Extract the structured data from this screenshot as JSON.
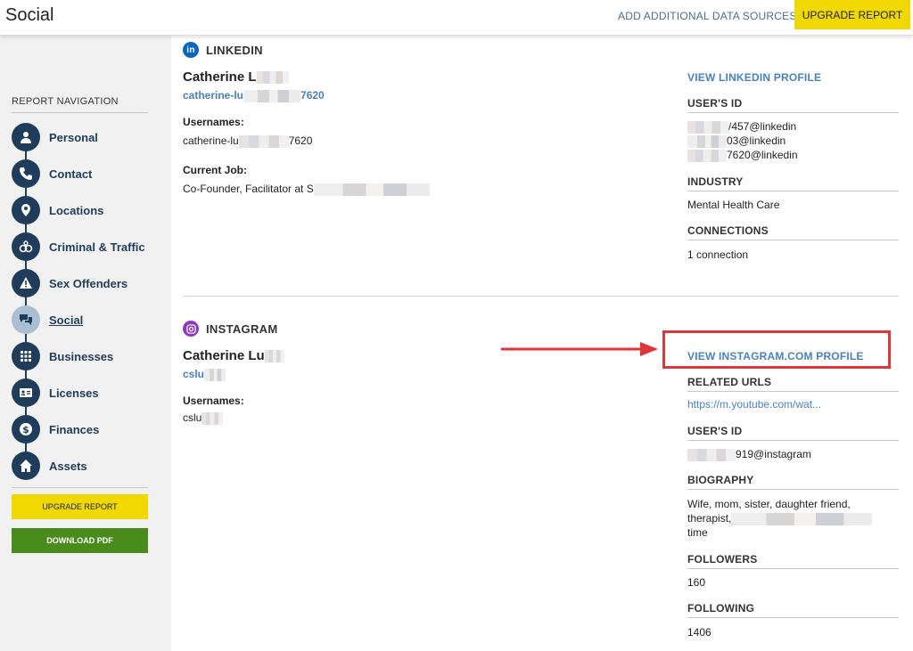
{
  "header": {
    "title": "Social",
    "add_sources": "ADD ADDITIONAL DATA SOURCES:",
    "upgrade": "UPGRADE REPORT"
  },
  "sidebar": {
    "heading": "REPORT NAVIGATION",
    "items": [
      {
        "label": "Personal",
        "icon": "person-icon"
      },
      {
        "label": "Contact",
        "icon": "phone-icon"
      },
      {
        "label": "Locations",
        "icon": "location-pin-icon"
      },
      {
        "label": "Criminal & Traffic",
        "icon": "handcuffs-icon"
      },
      {
        "label": "Sex Offenders",
        "icon": "warning-icon"
      },
      {
        "label": "Social",
        "icon": "chat-bubbles-icon",
        "active": true
      },
      {
        "label": "Businesses",
        "icon": "building-icon"
      },
      {
        "label": "Licenses",
        "icon": "id-card-icon"
      },
      {
        "label": "Finances",
        "icon": "dollar-icon"
      },
      {
        "label": "Assets",
        "icon": "home-icon"
      }
    ],
    "upgrade_button": "UPGRADE REPORT",
    "download_button": "DOWNLOAD PDF"
  },
  "linkedin": {
    "section_title": "LINKEDIN",
    "name": "Catherine L",
    "handle_prefix": "catherine-lu",
    "handle_suffix": "7620",
    "usernames_label": "Usernames:",
    "username_prefix": "catherine-lu",
    "username_suffix": "7620",
    "job_label": "Current Job:",
    "job_value": "Co-Founder, Facilitator at S",
    "view_profile": "VIEW LINKEDIN PROFILE",
    "user_id_label": "USER'S ID",
    "user_ids": [
      "/457@linkedin",
      "03@linkedin",
      "7620@linkedin"
    ],
    "industry_label": "INDUSTRY",
    "industry_value": "Mental Health Care",
    "connections_label": "CONNECTIONS",
    "connections_value": "1 connection"
  },
  "instagram": {
    "section_title": "INSTAGRAM",
    "name": "Catherine Lu",
    "handle": "cslu",
    "usernames_label": "Usernames:",
    "username": "cslu",
    "view_profile": "VIEW INSTAGRAM.COM PROFILE",
    "related_label": "RELATED URLS",
    "related_url": "https://m.youtube.com/wat...",
    "user_id_label": "USER'S ID",
    "user_id": "919@instagram",
    "bio_label": "BIOGRAPHY",
    "bio_line1": "Wife, mom, sister, daughter friend,",
    "bio_line2": "therapist,",
    "bio_line3": "time",
    "followers_label": "FOLLOWERS",
    "followers_value": "160",
    "following_label": "FOLLOWING",
    "following_value": "1406"
  },
  "annotation": {
    "highlight_color": "#e0363a"
  }
}
